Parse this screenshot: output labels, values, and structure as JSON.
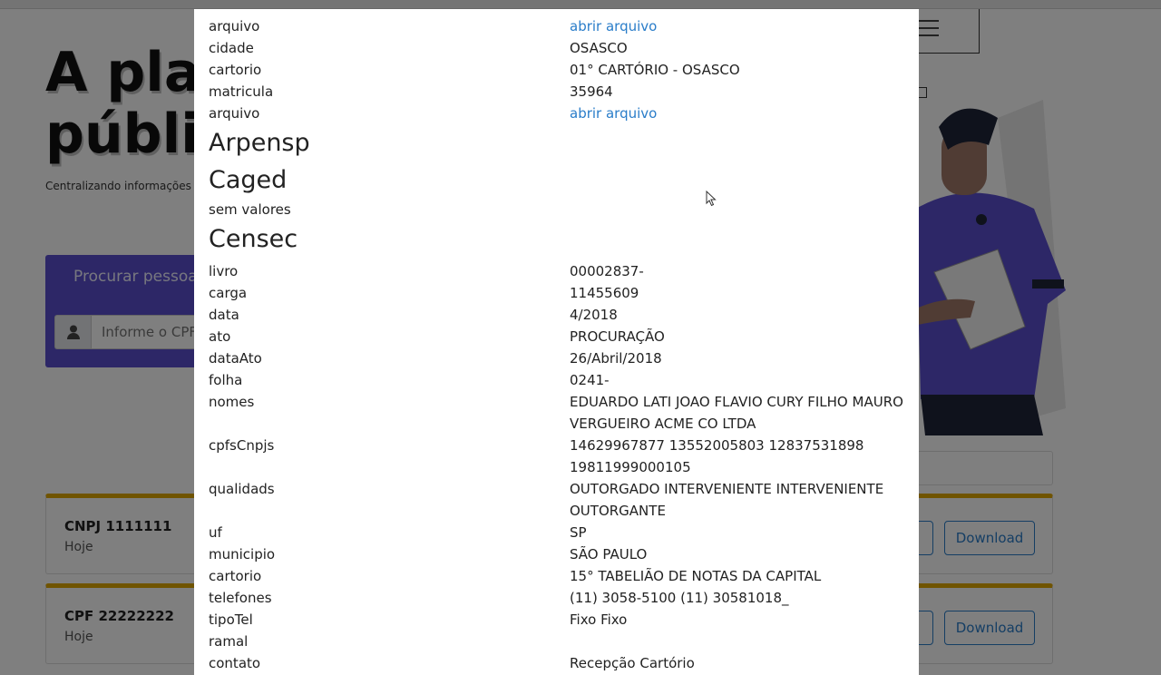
{
  "background": {
    "hero_title": "A plataforma de dados\npúblicos",
    "hero_subtitle": "Centralizando informações em um só lugar",
    "search_card_title": "Procurar pessoa",
    "search_placeholder": "Informe o CPF",
    "results": [
      {
        "title": "CNPJ 1111111",
        "date": "Hoje",
        "action_partial": "r",
        "download": "Download"
      },
      {
        "title": "CPF 22222222",
        "date": "Hoje",
        "action_partial": "r",
        "download": "Download"
      }
    ]
  },
  "modal": {
    "top_rows": [
      {
        "key": "arquivo",
        "value": "abrir arquivo",
        "link": true
      },
      {
        "key": "cidade",
        "value": "OSASCO"
      },
      {
        "key": "cartorio",
        "value": "01° CARTÓRIO - OSASCO"
      },
      {
        "key": "matricula",
        "value": "35964"
      },
      {
        "key": "arquivo",
        "value": "abrir arquivo",
        "link": true
      }
    ],
    "sections": {
      "arpensp": "Arpensp",
      "caged": "Caged",
      "caged_empty": "sem valores",
      "censec": "Censec"
    },
    "censec_rows": [
      {
        "key": "livro",
        "value": "00002837-"
      },
      {
        "key": "carga",
        "value": "11455609"
      },
      {
        "key": "data",
        "value": "4/2018"
      },
      {
        "key": "ato",
        "value": "PROCURAÇÃO"
      },
      {
        "key": "dataAto",
        "value": "26/Abril/2018"
      },
      {
        "key": "folha",
        "value": "0241-"
      },
      {
        "key": "nomes",
        "value": "EDUARDO LATI JOAO FLAVIO CURY FILHO MAURO VERGUEIRO ACME CO LTDA"
      },
      {
        "key": "cpfsCnpjs",
        "value": "14629967877 13552005803 12837531898 19811999000105"
      },
      {
        "key": "qualidads",
        "value": "OUTORGADO INTERVENIENTE INTERVENIENTE OUTORGANTE"
      },
      {
        "key": "uf",
        "value": "SP"
      },
      {
        "key": "municipio",
        "value": "SÃO PAULO"
      },
      {
        "key": "cartorio",
        "value": "15° TABELIÃO DE NOTAS DA CAPITAL"
      },
      {
        "key": "telefones",
        "value": "(11) 3058-5100 (11) 30581018_"
      },
      {
        "key": "tipoTel",
        "value": "Fixo Fixo"
      },
      {
        "key": "ramal",
        "value": ""
      },
      {
        "key": "contato",
        "value": "Recepção Cartório"
      }
    ]
  },
  "colors": {
    "brand_purple": "#5a4fcf",
    "link_blue": "#2a7dc9",
    "accent_yellow": "#e0a800",
    "backdrop": "rgba(0,0,0,0.5)"
  },
  "icons": [
    "user-icon",
    "hamburger-icon",
    "mouse-cursor-icon"
  ]
}
